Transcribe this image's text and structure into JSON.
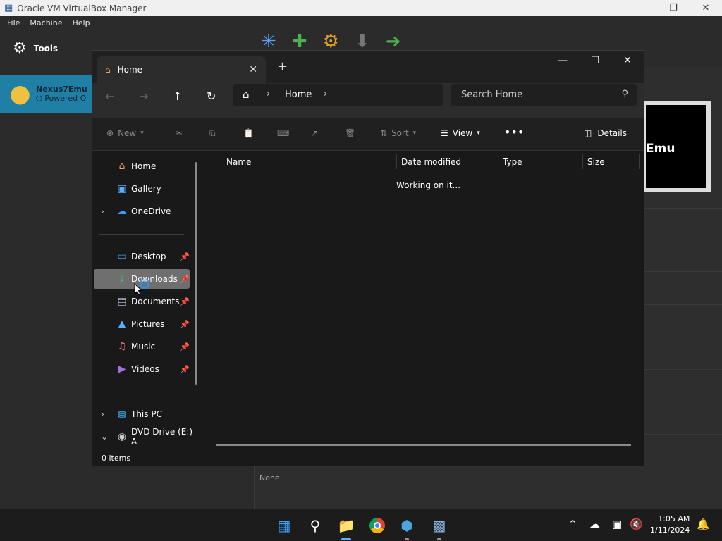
{
  "vbox": {
    "title": "Oracle VM VirtualBox Manager",
    "menu": [
      "File",
      "Machine",
      "Help"
    ],
    "tools_label": "Tools",
    "vm_name": "Nexus7Emu",
    "vm_status": "Powered O",
    "preview_text": "Emu",
    "bottom_text": "None"
  },
  "explorer": {
    "tab_label": "Home",
    "breadcrumb_label": "Home",
    "search_placeholder": "Search Home",
    "commands": {
      "new": "New",
      "sort": "Sort",
      "view": "View",
      "details": "Details"
    },
    "nav": {
      "home": "Home",
      "gallery": "Gallery",
      "onedrive": "OneDrive",
      "desktop": "Desktop",
      "downloads": "Downloads",
      "documents": "Documents",
      "pictures": "Pictures",
      "music": "Music",
      "videos": "Videos",
      "thispc": "This PC",
      "dvd": "DVD Drive (E:) A"
    },
    "columns": [
      "Name",
      "Date modified",
      "Type",
      "Size"
    ],
    "loading_text": "Working on it...",
    "status": "0 items"
  },
  "taskbar": {
    "time": "1:05 AM",
    "date": "1/11/2024"
  }
}
